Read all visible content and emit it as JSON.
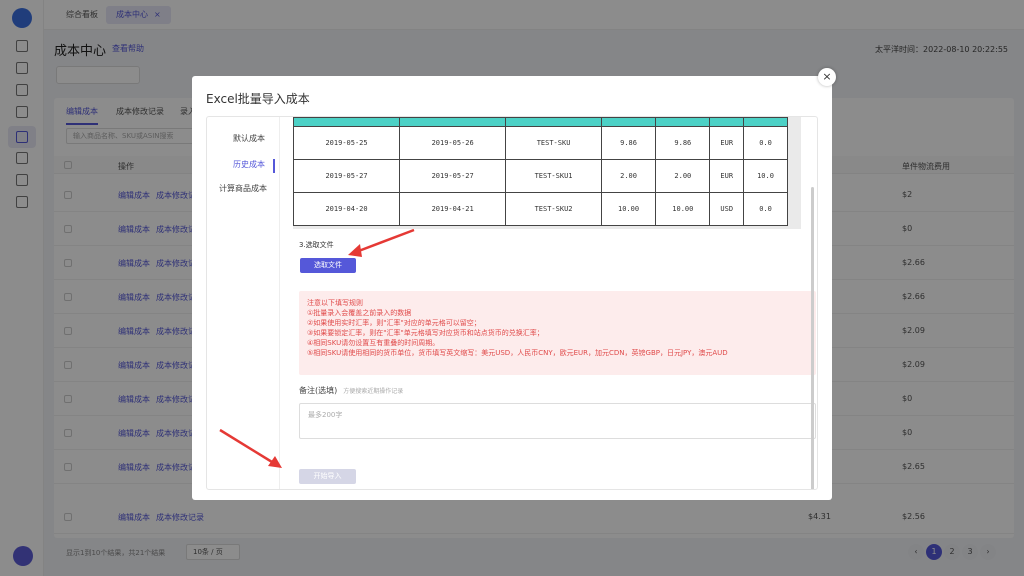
{
  "app": {
    "name": "成本中心"
  },
  "tabs": [
    {
      "label": "综合看板"
    },
    {
      "label": "成本中心"
    }
  ],
  "page": {
    "title": "成本中心",
    "help": "查看帮助",
    "timestamp": "太平洋时间：2022-08-10 20:22:55",
    "panel_tabs": [
      "编辑成本",
      "成本修改记录",
      "录入"
    ],
    "search_placeholder": "输入商品名称、SKU或ASIN搜索",
    "table_header": {
      "op": "操作",
      "col_shipping": "单件物流费用"
    },
    "rows": [
      {
        "edit": "编辑成本",
        "log": "成本修改记录",
        "shipping": "$2"
      },
      {
        "edit": "编辑成本",
        "log": "成本修改记录",
        "shipping": "$0"
      },
      {
        "edit": "编辑成本",
        "log": "成本修改记录",
        "shipping": "$2.66"
      },
      {
        "edit": "编辑成本",
        "log": "成本修改记录",
        "shipping": "$2.66"
      },
      {
        "edit": "编辑成本",
        "log": "成本修改记录",
        "shipping": "$2.09"
      },
      {
        "edit": "编辑成本",
        "log": "成本修改记录",
        "shipping": "$2.09"
      },
      {
        "edit": "编辑成本",
        "log": "成本修改记录",
        "shipping": "$0"
      },
      {
        "edit": "编辑成本",
        "log": "成本修改记录",
        "shipping": "$0"
      },
      {
        "edit": "编辑成本",
        "log": "成本修改记录",
        "shipping": "$2.65"
      },
      {
        "edit": "编辑成本",
        "log": "成本修改记录",
        "cost": "$4.31",
        "shipping": "$2.56"
      }
    ],
    "footer": "显示1到10个结果，共21个结果",
    "page_size": "10条 / 页",
    "pages": [
      "1",
      "2",
      "3"
    ]
  },
  "modal": {
    "title": "Excel批量导入成本",
    "close": "×",
    "side_tabs": [
      "默认成本",
      "历史成本",
      "计算商品成本"
    ],
    "sample_rows": [
      [
        "2019-05-25",
        "2019-05-26",
        "TEST-SKU",
        "9.86",
        "9.86",
        "EUR",
        "0.0"
      ],
      [
        "2019-05-27",
        "2019-05-27",
        "TEST-SKU1",
        "2.00",
        "2.00",
        "EUR",
        "10.0"
      ],
      [
        "2019-04-20",
        "2019-04-21",
        "TEST-SKU2",
        "10.00",
        "10.00",
        "USD",
        "0.0"
      ]
    ],
    "step3": "3.选取文件",
    "pick_file": "选取文件",
    "rules": [
      "注意以下填写规则",
      "①批量录入会覆盖之前录入的数据",
      "②如果使用实时汇率，则\"汇率\"对应的单元格可以留空；",
      "③如果要锁定汇率，则在\"汇率\"单元格填写对应货币和站点货币的兑换汇率；",
      "④相同SKU请勿设置互有重叠的时间周期。",
      "⑤相同SKU请使用相同的货币单位，货币填写英文缩写：美元USD，人民币CNY，欧元EUR，加元CDN，英镑GBP，日元JPY，澳元AUD"
    ],
    "note_label": "备注(选填)",
    "note_hint": "方便搜索近期操作记录",
    "note_placeholder": "最多200字",
    "start_import": "开始导入"
  }
}
